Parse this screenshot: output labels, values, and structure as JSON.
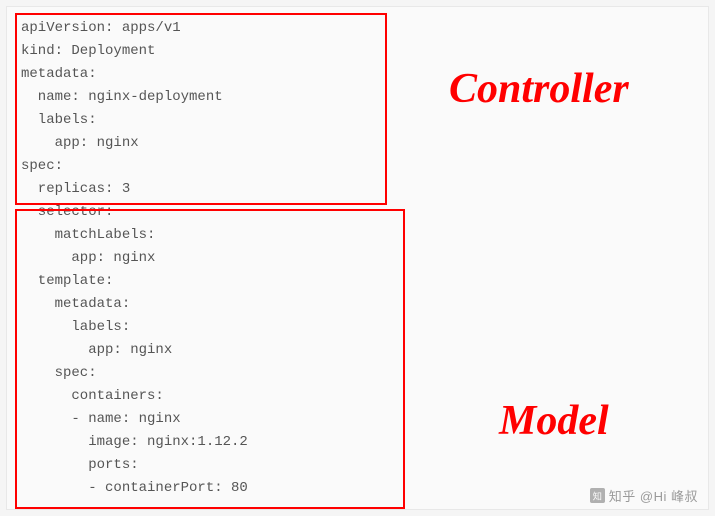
{
  "code": {
    "lines": [
      "apiVersion: apps/v1",
      "kind: Deployment",
      "metadata:",
      "  name: nginx-deployment",
      "  labels:",
      "    app: nginx",
      "spec:",
      "  replicas: 3",
      "  selector:",
      "    matchLabels:",
      "      app: nginx",
      "  template:",
      "    metadata:",
      "      labels:",
      "        app: nginx",
      "    spec:",
      "      containers:",
      "      - name: nginx",
      "        image: nginx:1.12.2",
      "        ports:",
      "        - containerPort: 80"
    ]
  },
  "labels": {
    "controller": "Controller",
    "model": "Model"
  },
  "watermark": {
    "site": "知乎",
    "author": "@Hi 峰叔"
  }
}
